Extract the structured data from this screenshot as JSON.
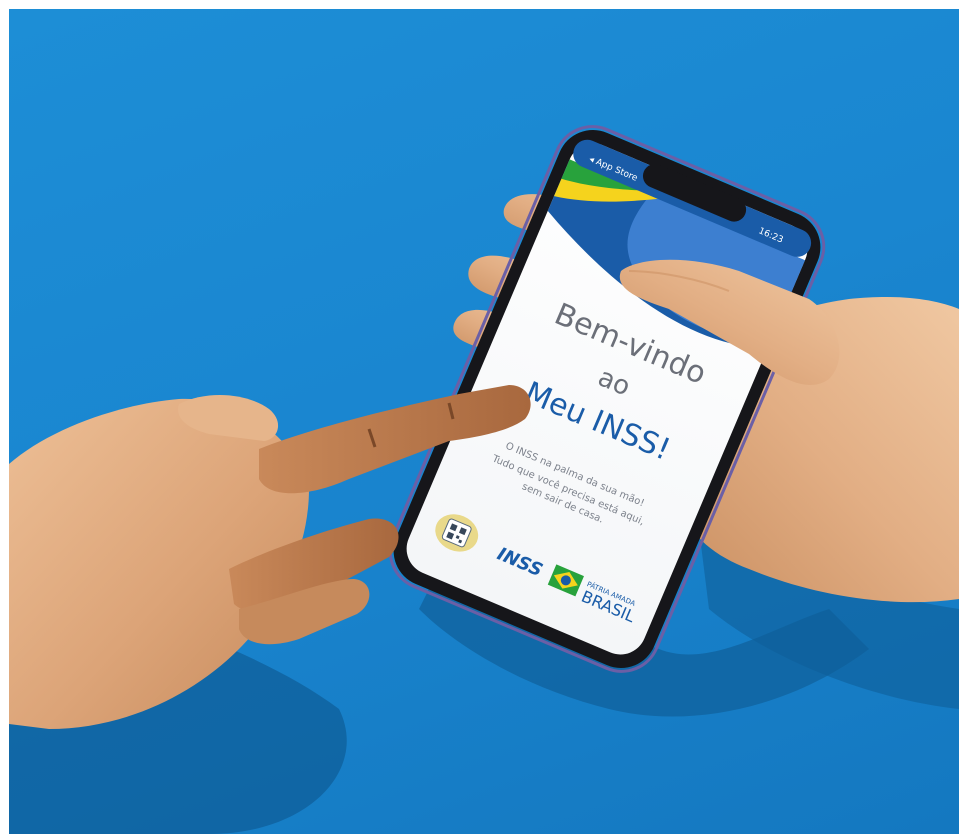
{
  "colors": {
    "background_blue": "#1a86d0",
    "wood_light": "#e2ac80",
    "wood_dark": "#b97c4e",
    "phone_frame": "#16161a",
    "screen_white": "#ffffff",
    "brand_blue": "#1a5ca8",
    "flag_green": "#28a23c",
    "flag_yellow": "#f5d31d"
  },
  "phone": {
    "status_bar": {
      "left": "◂ App Store",
      "time": "16:23"
    },
    "welcome": {
      "line1": "Bem-vindo",
      "line2": "ao",
      "line3": "Meu INSS!"
    },
    "subtitle": {
      "line1": "O INSS na palma da sua mão!",
      "line2": "Tudo que você precisa está aqui,",
      "line3": "sem sair de casa."
    },
    "footer": {
      "inss_label": "INSS",
      "patria_label": "PÁTRIA AMADA",
      "brasil_label": "BRASIL"
    }
  },
  "icons": [
    "qr-code-icon",
    "inss-logo",
    "brasil-flag-icon"
  ]
}
